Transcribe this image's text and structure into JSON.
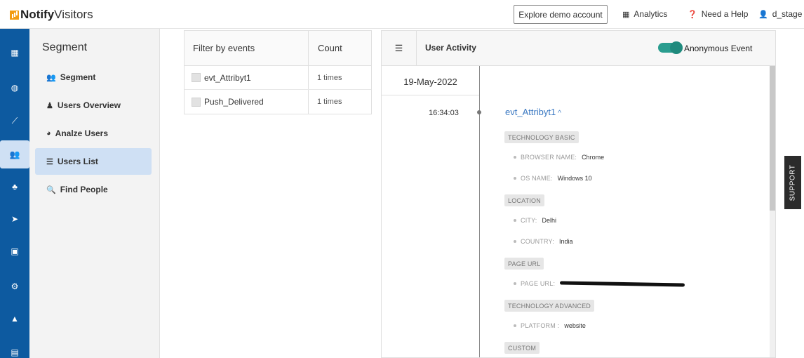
{
  "brand": {
    "bold": "Notify",
    "light": "Visitors"
  },
  "header": {
    "demo_button": "Explore demo account",
    "analytics": "Analytics",
    "help": "Need a Help",
    "user": "d_stage"
  },
  "rail": [
    {
      "icon": "grid-icon",
      "glyph": "▦"
    },
    {
      "icon": "dashboard-icon",
      "glyph": "◍"
    },
    {
      "icon": "line-chart-icon",
      "glyph": "⟋"
    },
    {
      "icon": "users-icon",
      "glyph": "👥",
      "active": true
    },
    {
      "icon": "sitemap-icon",
      "glyph": "♣"
    },
    {
      "icon": "send-icon",
      "glyph": "➤"
    },
    {
      "icon": "report-icon",
      "glyph": "▣"
    },
    {
      "icon": "gear-icon",
      "glyph": "⚙"
    },
    {
      "icon": "warning-icon",
      "glyph": "▲"
    },
    {
      "icon": "document-icon",
      "glyph": "▤"
    }
  ],
  "segment": {
    "title": "Segment",
    "items": [
      {
        "label": "Segment",
        "glyph": "👥"
      },
      {
        "label": "Users Overview",
        "glyph": "♟"
      },
      {
        "label": "Analze Users",
        "glyph": "◕"
      },
      {
        "label": "Users List",
        "glyph": "☰",
        "active": true
      },
      {
        "label": "Find People",
        "glyph": "🔍"
      }
    ]
  },
  "filter_table": {
    "headers": [
      "Filter by events",
      "Count"
    ],
    "rows": [
      {
        "event": "evt_Attribyt1",
        "count": "1 times"
      },
      {
        "event": "Push_Delivered",
        "count": "1 times"
      }
    ]
  },
  "activity": {
    "title": "User Activity",
    "toggle_label": "Anonymous Event",
    "toggle_on": true,
    "date": "19-May-2022",
    "time": "16:34:03",
    "event_title": "evt_Attribyt1",
    "sections": [
      {
        "label": "TECHNOLOGY BASIC"
      },
      {
        "label": "LOCATION"
      },
      {
        "label": "PAGE URL"
      },
      {
        "label": "TECHNOLOGY ADVANCED"
      },
      {
        "label": "CUSTOM"
      }
    ],
    "props": {
      "browser": {
        "key": "BROWSER NAME:",
        "value": "Chrome"
      },
      "os": {
        "key": "OS NAME:",
        "value": "Windows 10"
      },
      "city": {
        "key": "CITY:",
        "value": "Delhi"
      },
      "country": {
        "key": "COUNTRY:",
        "value": "India"
      },
      "page_url": {
        "key": "PAGE URL:",
        "value": ""
      },
      "platform": {
        "key": "PLATFORM :",
        "value": "website"
      }
    }
  },
  "support_label": "SUPPORT",
  "colors": {
    "rail": "#0d5aa0",
    "active_bg": "#cfe0f4",
    "toggle": "#2a9d8f",
    "link": "#3a78c2"
  }
}
